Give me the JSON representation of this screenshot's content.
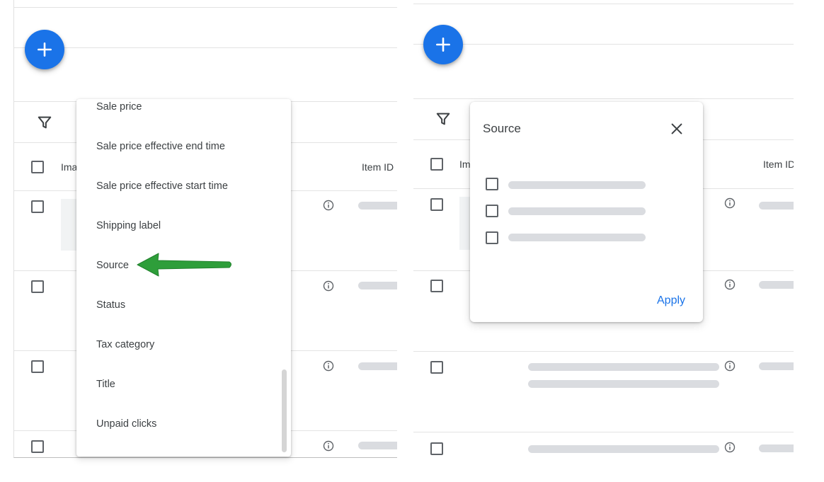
{
  "left_panel": {
    "header_col_partial": "Ima",
    "item_id_header": "Item ID",
    "menu": {
      "items": [
        "Sale price",
        "Sale price effective end time",
        "Sale price effective start time",
        "Shipping label",
        "Source",
        "Status",
        "Tax category",
        "Title",
        "Unpaid clicks"
      ],
      "highlighted": "Source"
    }
  },
  "right_panel": {
    "header_col_partial": "Im",
    "item_id_header": "Item ID",
    "dialog": {
      "title": "Source",
      "option_count": 3,
      "apply_label": "Apply"
    }
  },
  "icons": {
    "fab": "plus-icon",
    "filter": "filter-funnel-icon",
    "close": "close-icon",
    "info": "info-icon",
    "annotation": "green-arrow-icon"
  },
  "colors": {
    "accent": "#1a73e8",
    "arrow": "#2e9e3a",
    "skeleton": "#dadce0"
  }
}
